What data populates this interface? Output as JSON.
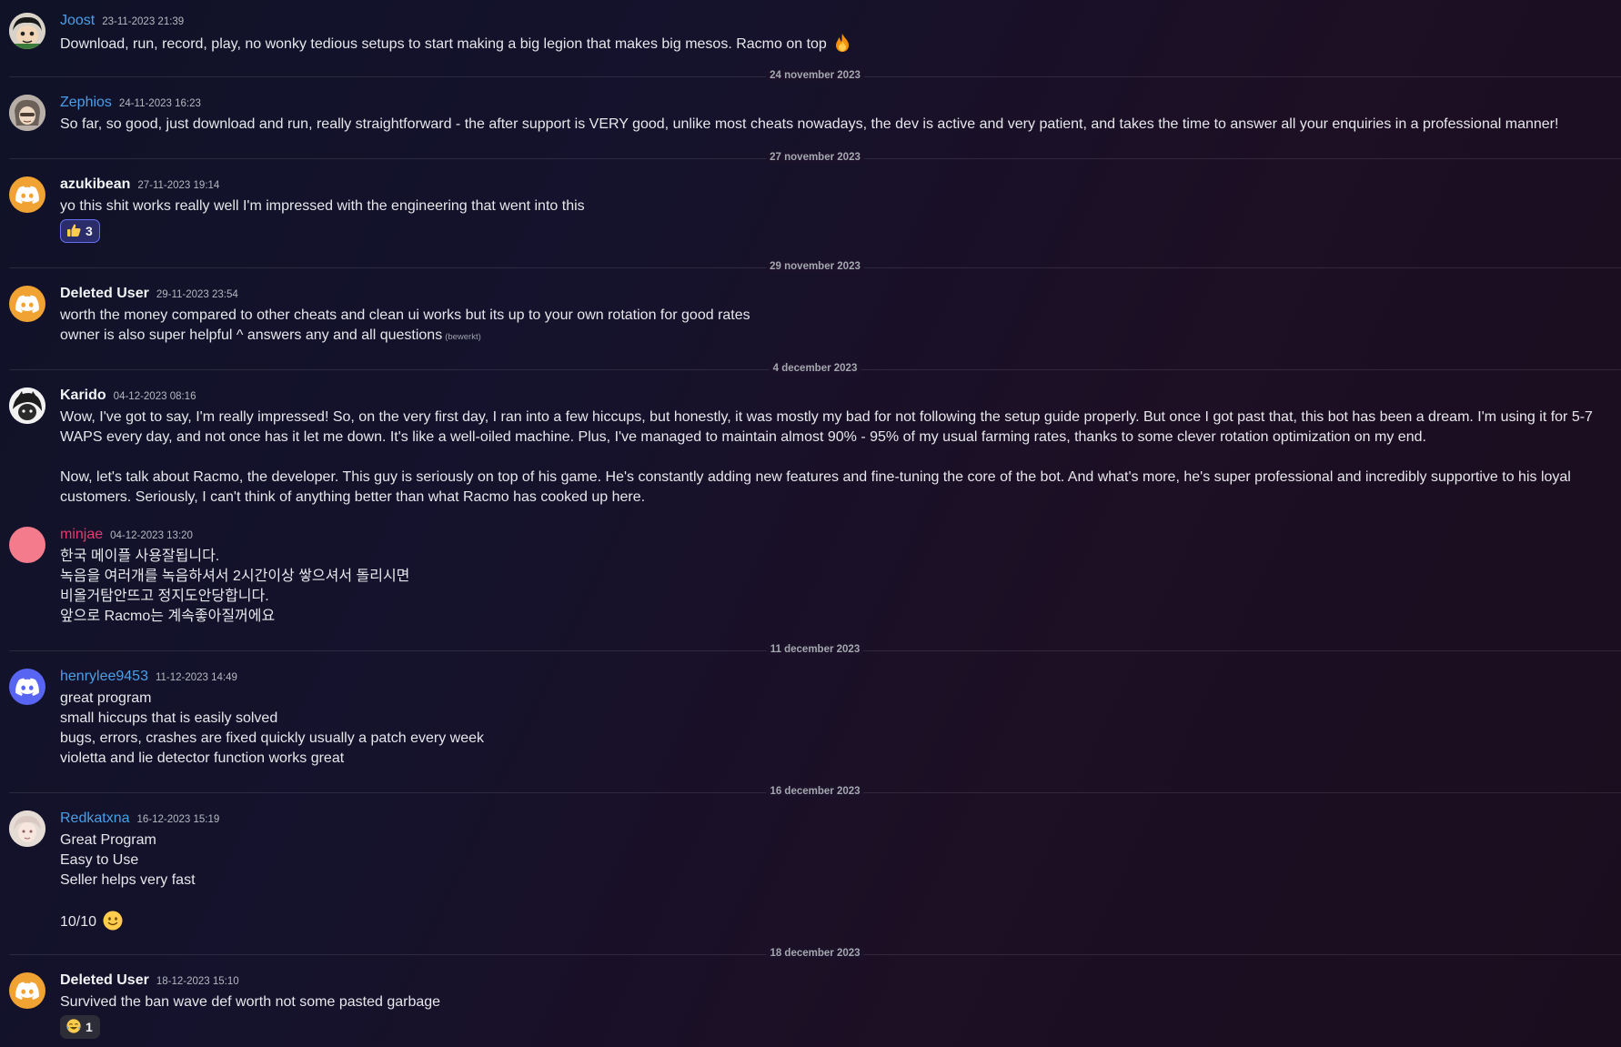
{
  "messages": [
    {
      "username": "Joost",
      "timestamp": "23-11-2023 21:39",
      "lines": [
        "Download, run, record, play, no wonky tedious setups to start making a big legion that makes big mesos. Racmo on top"
      ],
      "emoji": "fire-icon"
    },
    {
      "username": "Zephios",
      "timestamp": "24-11-2023 16:23",
      "lines": [
        "So far, so good, just download and run, really straightforward - the after support is VERY good, unlike most cheats nowadays, the dev is active and very patient, and takes the time to answer all your enquiries in a professional manner!"
      ]
    },
    {
      "username": "azukibean",
      "timestamp": "27-11-2023 19:14",
      "lines": [
        "yo this shit works really well I'm impressed with the engineering that went into this"
      ],
      "reaction": {
        "icon": "thumbs-up-icon",
        "count": "3"
      }
    },
    {
      "username": "Deleted User",
      "timestamp": "29-11-2023 23:54",
      "lines": [
        "worth the money compared to other cheats and clean ui works but its up to your own rotation for good rates",
        "owner is also super helpful ^ answers any and all questions"
      ],
      "edited": "(bewerkt)"
    },
    {
      "username": "Karido",
      "timestamp": "04-12-2023 08:16",
      "paragraphs": [
        "Wow, I've got to say, I'm really impressed! So, on the very first day, I ran into a few hiccups, but honestly, it was mostly my bad for not following the setup guide properly. But once I got past that, this bot has been a dream. I'm using it for 5-7 WAPS every day, and not once has it let me down. It's like a well-oiled machine. Plus, I've managed to maintain almost 90% - 95% of my usual farming rates, thanks to some clever rotation optimization on my end.",
        "Now, let's talk about Racmo, the developer. This guy is seriously on top of his game. He's constantly adding new features and fine-tuning the core of the bot. And what's more, he's super professional and incredibly supportive to his loyal customers. Seriously, I can't think of anything better than what Racmo has cooked up here."
      ]
    },
    {
      "username": "minjae",
      "timestamp": "04-12-2023 13:20",
      "lines": [
        "한국 메이플 사용잘됩니다.",
        "녹음을 여러개를 녹음하셔서 2시간이상 쌓으셔서 돌리시면",
        "비올거탐안뜨고 정지도안당합니다.",
        "앞으로 Racmo는 계속좋아질꺼에요"
      ]
    },
    {
      "username": "henrylee9453",
      "timestamp": "11-12-2023 14:49",
      "lines": [
        "great program",
        "small hiccups that is easily solved",
        "bugs, errors, crashes are fixed quickly usually a patch every week",
        "violetta and lie detector function works great"
      ]
    },
    {
      "username": "Redkatxna",
      "timestamp": "16-12-2023 15:19",
      "lines": [
        "Great Program",
        "Easy to Use",
        "Seller helps very fast"
      ],
      "last_line": "10/10",
      "emoji": "slight-smile-icon"
    },
    {
      "username": "Deleted User",
      "timestamp": "18-12-2023 15:10",
      "lines": [
        "Survived the ban wave def worth not some pasted garbage"
      ],
      "reaction": {
        "icon": "joy-icon",
        "count": "1"
      }
    }
  ],
  "dividers": [
    "24 november 2023",
    "27 november 2023",
    "29 november 2023",
    "4 december 2023",
    "11 december 2023",
    "16 december 2023",
    "18 december 2023"
  ],
  "colors": {
    "username_blue": "#4a9fe8",
    "username_red": "#e8386f",
    "discord_orange": "#f0a232",
    "discord_blurple": "#5865f2"
  }
}
